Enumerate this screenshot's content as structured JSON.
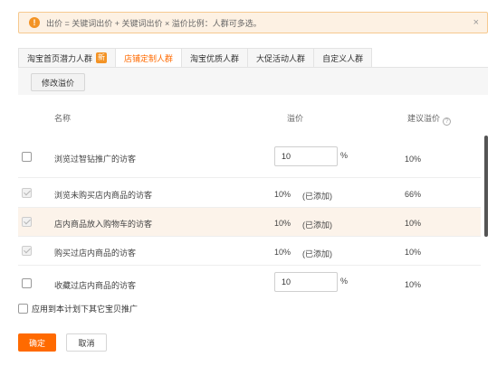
{
  "alert": {
    "icon": "warning-icon",
    "message": "出价 = 关键词出价 + 关键词出价 × 溢价比例：人群可多选。",
    "close": "×"
  },
  "tabs": [
    {
      "label": "淘宝首页潜力人群",
      "badge": "新"
    },
    {
      "label": "店铺定制人群"
    },
    {
      "label": "淘宝优质人群"
    },
    {
      "label": "大促活动人群"
    },
    {
      "label": "自定义人群"
    }
  ],
  "toolbar": {
    "modify_label": "修改溢价"
  },
  "table": {
    "headers": {
      "name": "名称",
      "premium": "溢价",
      "suggested": "建议溢价",
      "help_icon": "question-icon"
    },
    "rows": [
      {
        "checked": false,
        "name": "浏览过智钻推广的访客",
        "premium_input": "10",
        "unit": "%",
        "suggested": "10%"
      },
      {
        "checked": true,
        "name": "浏览未购买店内商品的访客",
        "premium": "10%",
        "added": "(已添加)",
        "suggested": "66%"
      },
      {
        "checked": true,
        "name": "店内商品放入购物车的访客",
        "premium": "10%",
        "added": "(已添加)",
        "suggested": "10%"
      },
      {
        "checked": true,
        "name": "购买过店内商品的访客",
        "premium": "10%",
        "added": "(已添加)",
        "suggested": "10%"
      },
      {
        "checked": false,
        "name": "收藏过店内商品的访客",
        "premium_input": "10",
        "unit": "%",
        "suggested": "10%"
      }
    ]
  },
  "apply_label": "应用到本计划下其它宝贝推广",
  "footer": {
    "ok_label": "确定",
    "cancel_label": "取消"
  },
  "colors": {
    "accent": "#ff6a00",
    "alert_bg": "#fdf1e3",
    "warning": "#f39325"
  }
}
